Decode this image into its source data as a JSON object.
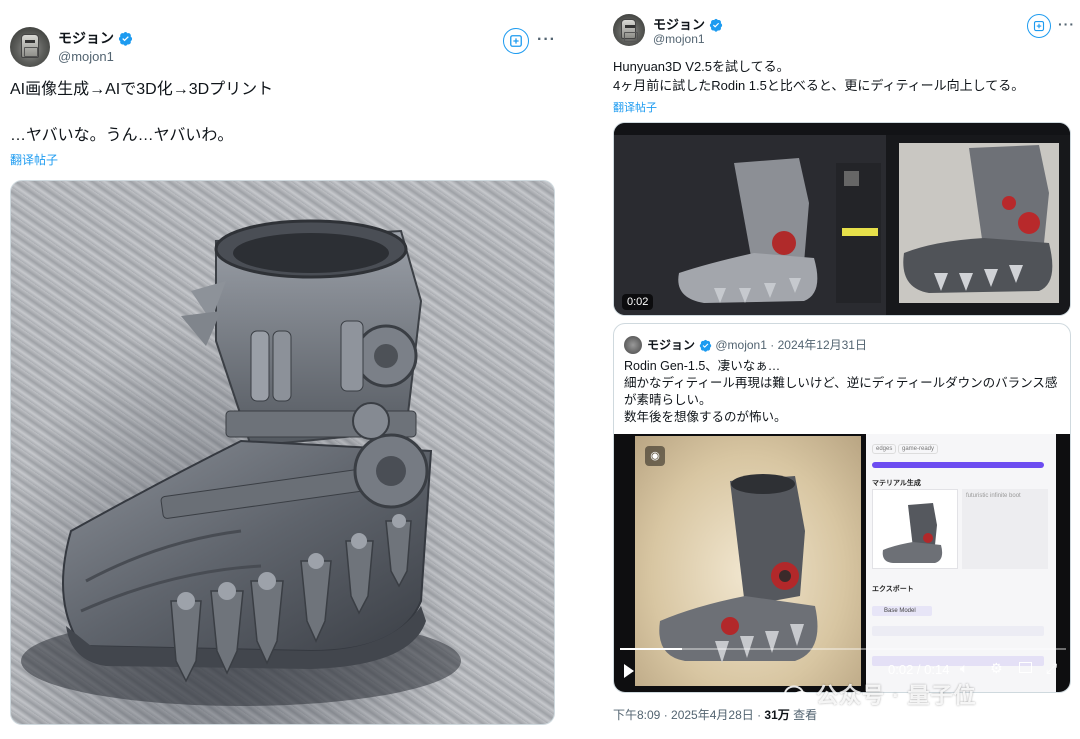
{
  "left_tweet": {
    "author_name": "モジョン",
    "author_handle": "@mojon1",
    "text_line1": "AI画像生成→AIで3D化→3Dプリント",
    "text_line2": "…ヤバいな。うん…ヤバいわ。",
    "translate_label": "翻译帖子",
    "media_alt": "3D printed grey mechanical boot on textured metal surface",
    "more_label": "···"
  },
  "right_tweet": {
    "author_name": "モジョン",
    "author_handle": "@mojon1",
    "text_line1": "Hunyuan3D V2.5を試してる。",
    "text_line2": "4ヶ月前に試したRodin 1.5と比べると、更にディティール向上してる。",
    "translate_label": "翻译帖子",
    "video_time": "0:02",
    "more_label": "···",
    "quote": {
      "author_name": "モジョン",
      "author_handle": "@mojon1",
      "date": "2024年12月31日",
      "line1": "Rodin Gen-1.5、凄いなぁ…",
      "line2": "細かなディティール再現は難しいけど、逆にディティールダウンのバランス感が素晴らしい。",
      "line3": "数年後を想像するのが怖い。",
      "video_time": "0:02 / 0:14",
      "panel_material": "マテリアル生成",
      "panel_export": "エクスポート",
      "panel_base_model": "Base Model",
      "panel_tag1": "edges",
      "panel_tag2": "game-ready",
      "panel_placeholder": "futuristic infinite boot"
    },
    "timestamp": "下午8:09 · 2025年4月28日 · ",
    "views_count": "31万",
    "views_label": " 查看"
  },
  "watermark": "公众号 · 量子位",
  "colors": {
    "accent": "#1d9bf0",
    "verified": "#1d9bf0",
    "text": "#0f1419",
    "muted": "#536471",
    "purple": "#6c4cf1"
  }
}
